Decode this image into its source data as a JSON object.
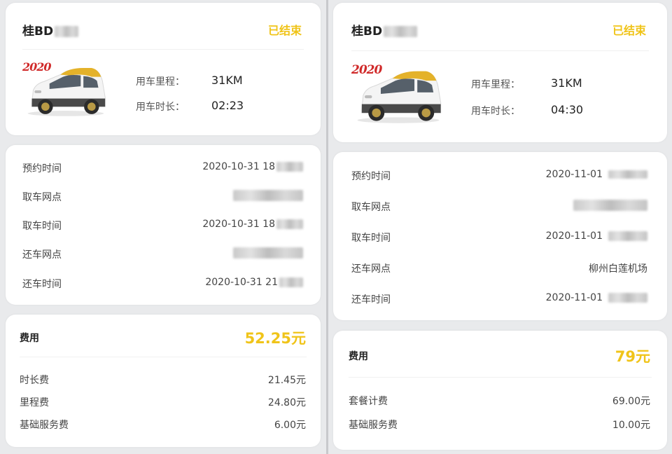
{
  "left": {
    "plate": "桂BD",
    "status": "已结束",
    "mileage_label": "用车里程：",
    "mileage_value": "31KM",
    "duration_label": "用车时长：",
    "duration_value": "02:23",
    "details": [
      {
        "label": "预约时间",
        "value": "2020-10-31 18"
      },
      {
        "label": "取车网点",
        "value": ""
      },
      {
        "label": "取车时间",
        "value": "2020-10-31 18"
      },
      {
        "label": "还车网点",
        "value": ""
      },
      {
        "label": "还车时间",
        "value": "2020-10-31 21"
      }
    ],
    "fee_title": "费用",
    "fee_total": "52.25元",
    "fee_items": [
      {
        "label": "时长费",
        "value": "21.45元"
      },
      {
        "label": "里程费",
        "value": "24.80元"
      },
      {
        "label": "基础服务费",
        "value": "6.00元"
      }
    ]
  },
  "right": {
    "plate": "桂BD",
    "status": "已结束",
    "mileage_label": "用车里程：",
    "mileage_value": "31KM",
    "duration_label": "用车时长：",
    "duration_value": "04:30",
    "details": [
      {
        "label": "预约时间",
        "value": "2020-11-01"
      },
      {
        "label": "取车网点",
        "value": ""
      },
      {
        "label": "取车时间",
        "value": "2020-11-01"
      },
      {
        "label": "还车网点",
        "value": "柳州白莲机场"
      },
      {
        "label": "还车时间",
        "value": "2020-11-01"
      }
    ],
    "fee_title": "费用",
    "fee_total": "79元",
    "fee_items": [
      {
        "label": "套餐计费",
        "value": "69.00元"
      },
      {
        "label": "基础服务费",
        "value": "10.00元"
      }
    ]
  },
  "car_logo_text": "2020",
  "colors": {
    "accent": "#f0c419",
    "car_body": "#f4f4f4",
    "car_roof": "#e4b22a"
  }
}
